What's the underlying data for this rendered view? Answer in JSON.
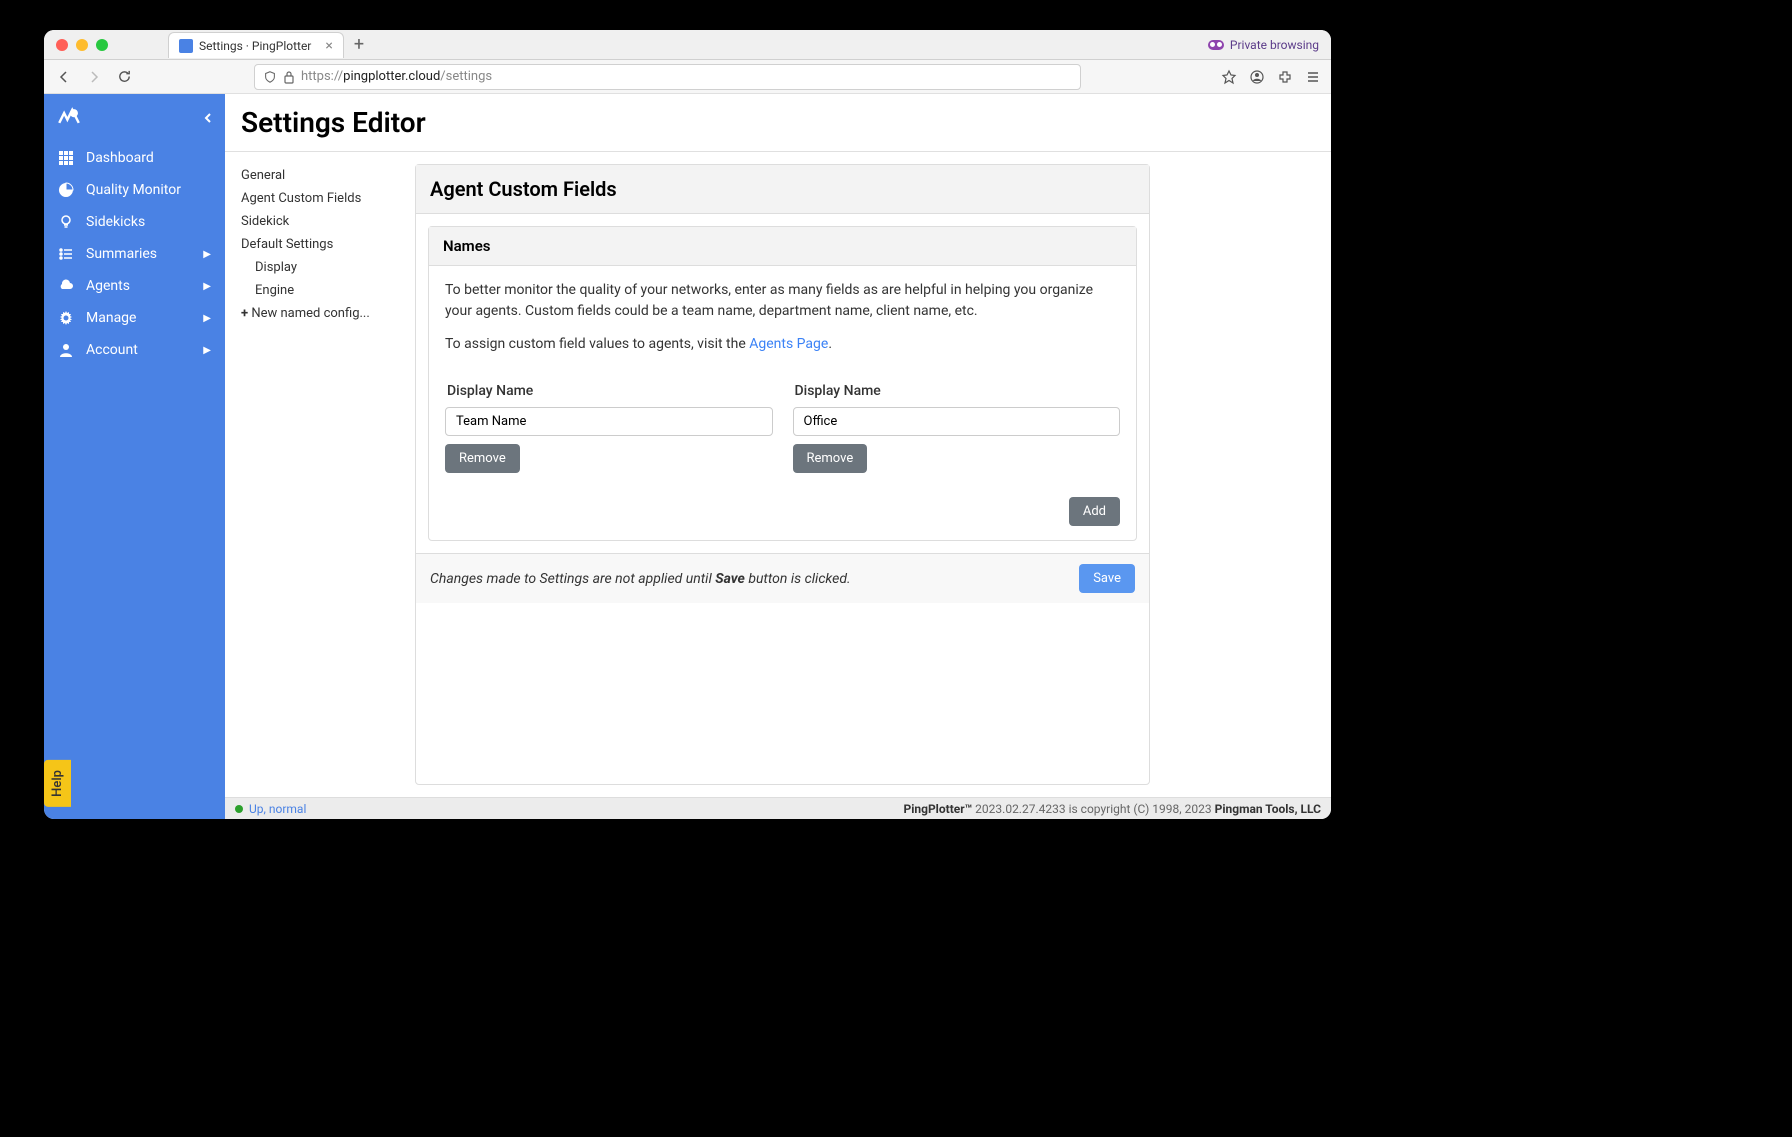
{
  "browser": {
    "tab_title": "Settings · PingPlotter",
    "url_prefix": "https://",
    "url_domain": "pingplotter.cloud",
    "url_path": "/settings",
    "private": "Private browsing"
  },
  "sidebar": {
    "items": [
      {
        "label": "Dashboard",
        "expandable": false
      },
      {
        "label": "Quality Monitor",
        "expandable": false
      },
      {
        "label": "Sidekicks",
        "expandable": false
      },
      {
        "label": "Summaries",
        "expandable": true
      },
      {
        "label": "Agents",
        "expandable": true
      },
      {
        "label": "Manage",
        "expandable": true
      },
      {
        "label": "Account",
        "expandable": true
      }
    ],
    "help": "Help"
  },
  "page": {
    "title": "Settings Editor",
    "nav": {
      "general": "General",
      "agent_custom_fields": "Agent Custom Fields",
      "sidekick": "Sidekick",
      "default_settings": "Default Settings",
      "display": "Display",
      "engine": "Engine",
      "new_named": "New named config..."
    }
  },
  "panel": {
    "title": "Agent Custom Fields",
    "card_title": "Names",
    "desc1": "To better monitor the quality of your networks, enter as many fields as are helpful in helping you organize your agents. Custom fields could be a team name, department name, client name, etc.",
    "desc2a": "To assign custom field values to agents, visit the ",
    "desc2link": "Agents Page",
    "desc2b": ".",
    "field_label": "Display Name",
    "fields": [
      {
        "value": "Team Name"
      },
      {
        "value": "Office"
      }
    ],
    "remove": "Remove",
    "add": "Add",
    "footer_a": "Changes made to Settings are not applied until ",
    "footer_bold": "Save",
    "footer_b": " button is clicked.",
    "save": "Save"
  },
  "status": {
    "text": "Up, normal",
    "product": "PingPlotter™",
    "version": " 2023.02.27.4233 is copyright (C) 1998, 2023 ",
    "company": "Pingman Tools, LLC"
  }
}
